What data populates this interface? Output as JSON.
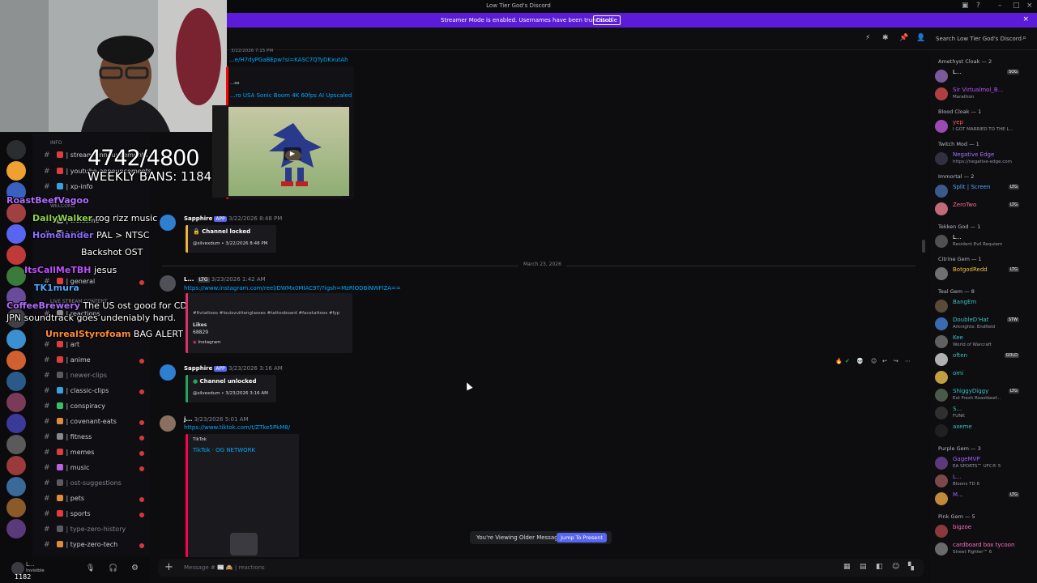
{
  "window": {
    "title": "Low Tier God's Discord"
  },
  "banner": {
    "message": "Streamer Mode is enabled. Usernames have been truncated.",
    "disable_label": "Disable"
  },
  "header": {
    "search_placeholder": "Search Low Tier God's Discord"
  },
  "overlay": {
    "counter": "4742/4800",
    "weekly_bans": "WEEKLY BANS: 1184",
    "chat": [
      {
        "user": "RoastBeefVagoo",
        "text": "",
        "color": "#b06cff"
      },
      {
        "user": "DailyWalker",
        "text": "rog rizz music",
        "color": "#8fd24f"
      },
      {
        "user": "Homelander",
        "text": "PAL > NTSC",
        "color": "#8a6cff"
      },
      {
        "user": "",
        "text": "Backshot OST",
        "color": "#ff5a5a"
      },
      {
        "user": "ItsCallMeTBH",
        "text": "jesus",
        "color": "#c050ff"
      },
      {
        "user": "TK1mura",
        "text": "",
        "color": "#4aa8ff"
      },
      {
        "user": "CoffeeBrewery",
        "text": "The US ost good for CD but the JPN soundtrack goes undeniably hard.",
        "color": "#b06cff"
      },
      {
        "user": "UnrealStyrofoam",
        "text": "BAG ALERT",
        "color": "#ff8a3a"
      }
    ]
  },
  "channels": [
    {
      "name": "INFO",
      "category": true
    },
    {
      "name": "| stream-announcements",
      "muted": false,
      "badge": false,
      "icon_color": "#e03c3c"
    },
    {
      "name": "| youtube-announcements",
      "muted": false,
      "badge": false,
      "icon_color": "#e03c3c"
    },
    {
      "name": "| xp-info",
      "muted": false,
      "badge": false,
      "icon_color": "#3aa0e0"
    },
    {
      "name": "WELCOME",
      "category": true
    },
    {
      "name": "| welcome",
      "muted": false,
      "badge": false,
      "icon_color": "#8a8a8a"
    },
    {
      "name": "| rules",
      "muted": false,
      "badge": false,
      "icon_color": "#8a8a8a"
    },
    {
      "name": "| general",
      "muted": false,
      "badge": true,
      "icon_color": "#e03c3c"
    },
    {
      "name": "LIVE STREAM CONTENT",
      "category": true
    },
    {
      "name": "| reactions",
      "muted": false,
      "badge": false,
      "icon_color": "#8a8a8a"
    },
    {
      "name": "| art",
      "muted": false,
      "badge": false,
      "icon_color": "#e03c3c"
    },
    {
      "name": "| anime",
      "muted": false,
      "badge": true,
      "icon_color": "#e03c3c"
    },
    {
      "name": "| newer-clips",
      "muted": true,
      "badge": false,
      "icon_color": "#5a5a60"
    },
    {
      "name": "| classic-clips",
      "muted": false,
      "badge": true,
      "icon_color": "#3aa0e0"
    },
    {
      "name": "| conspiracy",
      "muted": false,
      "badge": false,
      "icon_color": "#3ac060"
    },
    {
      "name": "| covenant-eats",
      "muted": false,
      "badge": true,
      "icon_color": "#e08a3c"
    },
    {
      "name": "| fitness",
      "muted": false,
      "badge": true,
      "icon_color": "#8a8a8a"
    },
    {
      "name": "| memes",
      "muted": false,
      "badge": true,
      "icon_color": "#e03c3c"
    },
    {
      "name": "| music",
      "muted": false,
      "badge": true,
      "icon_color": "#c060e0"
    },
    {
      "name": "| ost-suggestions",
      "muted": true,
      "badge": false,
      "icon_color": "#5a5a60"
    },
    {
      "name": "| pets",
      "muted": false,
      "badge": true,
      "icon_color": "#e08a3c"
    },
    {
      "name": "| sports",
      "muted": false,
      "badge": true,
      "icon_color": "#e03c3c"
    },
    {
      "name": "| type-zero-history",
      "muted": true,
      "badge": false,
      "icon_color": "#5a5a60"
    },
    {
      "name": "| type-zero-tech",
      "muted": false,
      "badge": true,
      "icon_color": "#e08a3c"
    }
  ],
  "userbar": {
    "name": "L...",
    "status": "Invisible",
    "count": "1182"
  },
  "messages": {
    "m1": {
      "timestamp": "3/22/2026 7:15 PM",
      "link": "...e/H7dyPGaBEpw?si=KASC7QTyDKxutAh",
      "embed_title": "...ro USA Sonic Boom 4K 60fps AI Upscaled",
      "embed_provider": "...so"
    },
    "m2": {
      "author": "Sapphire",
      "badge": "APP",
      "timestamp": "3/22/2026 8:48 PM",
      "embed_title": "Channel locked",
      "embed_footer": "@silvexdum • 3/22/2026 8:48 PM"
    },
    "divider": "March 23, 2026",
    "m3": {
      "author": "L...",
      "tag": "LTG",
      "timestamp": "3/23/2026 1:42 AM",
      "link": "https://www.instagram.com/reel/DWMx0MlAC9T/?igsh=MzRlODBiNWFlZA==",
      "embed_desc": "#ltvtattoos #louisvuittonglasses #tattooboard #facetattoos #fyp",
      "likes_label": "Likes",
      "likes_count": "68829",
      "provider": "Instagram"
    },
    "m4": {
      "author": "Sapphire",
      "badge": "APP",
      "timestamp": "3/23/2026 3:16 AM",
      "embed_title": "Channel unlocked",
      "embed_footer": "@silvexdum • 3/23/2026 3:16 AM"
    },
    "m5": {
      "author": "j...",
      "timestamp": "3/23/2026 5:01 AM",
      "link": "https://www.tiktok.com/t/ZTke5PkM8/",
      "provider": "TikTok",
      "embed_title": "TikTok · OG NETWORK"
    }
  },
  "older": {
    "label": "You're Viewing Older Messages",
    "jump": "Jump To Present"
  },
  "composer": {
    "placeholder": "Message # 📰 🙈 | reactions"
  },
  "members": {
    "roles": [
      {
        "label": "Amethyst Cloak — 2",
        "members": [
          {
            "name": "L...",
            "status": "",
            "tag": "SOG",
            "color": "#ffffff",
            "av": "#7a5a9a"
          },
          {
            "name": "Sir Virtualmol_B...",
            "status": "Marathon",
            "tag": "",
            "color": "#c050ff",
            "av": "#b04040"
          }
        ]
      },
      {
        "label": "Blood Cloak — 1",
        "members": [
          {
            "name": "yep",
            "status": "I GOT MARRIED TO THE L...",
            "tag": "",
            "color": "#ff5a5a",
            "av": "#9a4ab0"
          }
        ]
      },
      {
        "label": "Twitch Mod — 1",
        "members": [
          {
            "name": "Negative Edge",
            "status": "https://negative-edge.com",
            "tag": "",
            "color": "#a070ff",
            "av": "#303040"
          }
        ]
      },
      {
        "label": "Immortal — 2",
        "members": [
          {
            "name": "Split | Screen",
            "status": "",
            "tag": "LTG",
            "color": "#4aa8ff",
            "av": "#3a5a8a"
          },
          {
            "name": "ZeroTwo",
            "status": "",
            "tag": "LTG",
            "color": "#ff6a8a",
            "av": "#c06a7a"
          }
        ]
      },
      {
        "label": "Tekken God — 1",
        "members": [
          {
            "name": "L...",
            "status": "Resident Evil Requiem",
            "tag": "",
            "color": "#ffffff",
            "av": "#505050"
          }
        ]
      },
      {
        "label": "Citrine Gem — 1",
        "members": [
          {
            "name": "BotgodRedd",
            "status": "",
            "tag": "LTG",
            "color": "#f0c040",
            "av": "#707070"
          }
        ]
      },
      {
        "label": "Teal Gem — 8",
        "members": [
          {
            "name": "BangEm",
            "status": "",
            "tag": "",
            "color": "#3ac0c0",
            "av": "#5a4a3a"
          },
          {
            "name": "DoubleD'Hat",
            "status": "Arknights: Endfield",
            "tag": "STW",
            "color": "#3ac0c0",
            "av": "#3a6ab0"
          },
          {
            "name": "Kee",
            "status": "World of Warcraft",
            "tag": "",
            "color": "#3ac0c0",
            "av": "#606060"
          },
          {
            "name": "often",
            "status": "",
            "tag": "GOLD",
            "color": "#3ac0c0",
            "av": "#b0b0b0"
          },
          {
            "name": "omi",
            "status": "",
            "tag": "",
            "color": "#3ac0c0",
            "av": "#c0a040"
          },
          {
            "name": "ShiggyDiggy",
            "status": "Ext Fresh Roastbeef...",
            "tag": "LTG",
            "color": "#3ac0c0",
            "av": "#4a5a4a"
          },
          {
            "name": "S...",
            "status": "FUNK",
            "tag": "",
            "color": "#3ac0c0",
            "av": "#303030"
          },
          {
            "name": "axeme",
            "status": "",
            "tag": "",
            "color": "#3ac0c0",
            "av": "#202020"
          }
        ]
      },
      {
        "label": "Purple Gem — 3",
        "members": [
          {
            "name": "GageMVP",
            "status": "EA SPORTS™ UFC® 5",
            "tag": "",
            "color": "#a060ff",
            "av": "#5a3a7a"
          },
          {
            "name": "L...",
            "status": "Bloons TD 6",
            "tag": "",
            "color": "#a060ff",
            "av": "#7a4a4a"
          },
          {
            "name": "M...",
            "status": "",
            "tag": "LTG",
            "color": "#a060ff",
            "av": "#c08a3a"
          }
        ]
      },
      {
        "label": "Pink Gem — 5",
        "members": [
          {
            "name": "bigzoe",
            "status": "",
            "tag": "",
            "color": "#ff70c0",
            "av": "#8a3a3a"
          },
          {
            "name": "cardboard box tycoon",
            "status": "Street Fighter™ 6",
            "tag": "",
            "color": "#ff70c0",
            "av": "#6a6a6a"
          }
        ]
      }
    ]
  }
}
